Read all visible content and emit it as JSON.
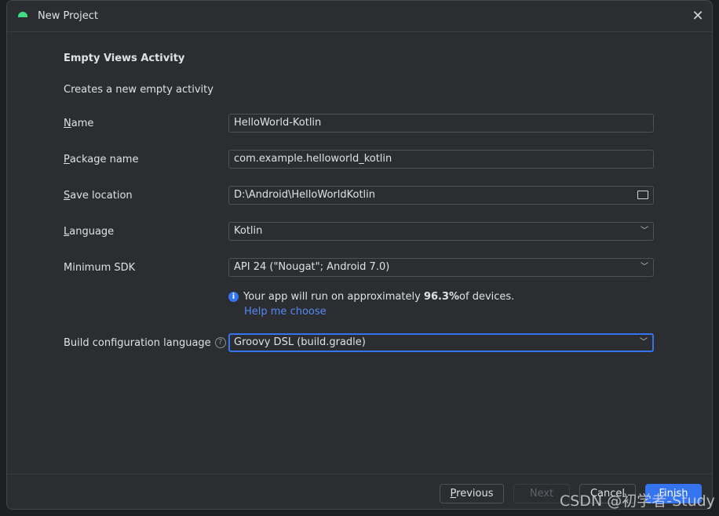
{
  "dialog": {
    "title": "New Project"
  },
  "heading": "Empty Views Activity",
  "description": "Creates a new empty activity",
  "fields": {
    "name": {
      "m": "N",
      "rest": "ame",
      "value": "HelloWorld-Kotlin"
    },
    "package": {
      "m": "P",
      "rest": "ackage name",
      "value": "com.example.helloworld_kotlin"
    },
    "save": {
      "m": "S",
      "rest": "ave location",
      "value": "D:\\Android\\HelloWorldKotlin"
    },
    "language": {
      "m": "L",
      "rest": "anguage",
      "value": "Kotlin"
    },
    "sdk": {
      "label": "Minimum SDK",
      "value": "API 24 (\"Nougat\"; Android 7.0)"
    },
    "build": {
      "label": "Build configuration language",
      "value": "Groovy DSL (build.gradle)"
    }
  },
  "info": {
    "pre": "Your app will run on approximately ",
    "pct": "96.3%",
    "post": " of devices.",
    "link": "Help me choose"
  },
  "buttons": {
    "prev_m": "P",
    "prev_rest": "revious",
    "next": "Next",
    "cancel": "Cancel",
    "finish": "Finish"
  },
  "watermark": "CSDN @初学者-Study",
  "colors": {
    "accent": "#3574f0",
    "link": "#548af7",
    "android": "#3ddc84"
  }
}
